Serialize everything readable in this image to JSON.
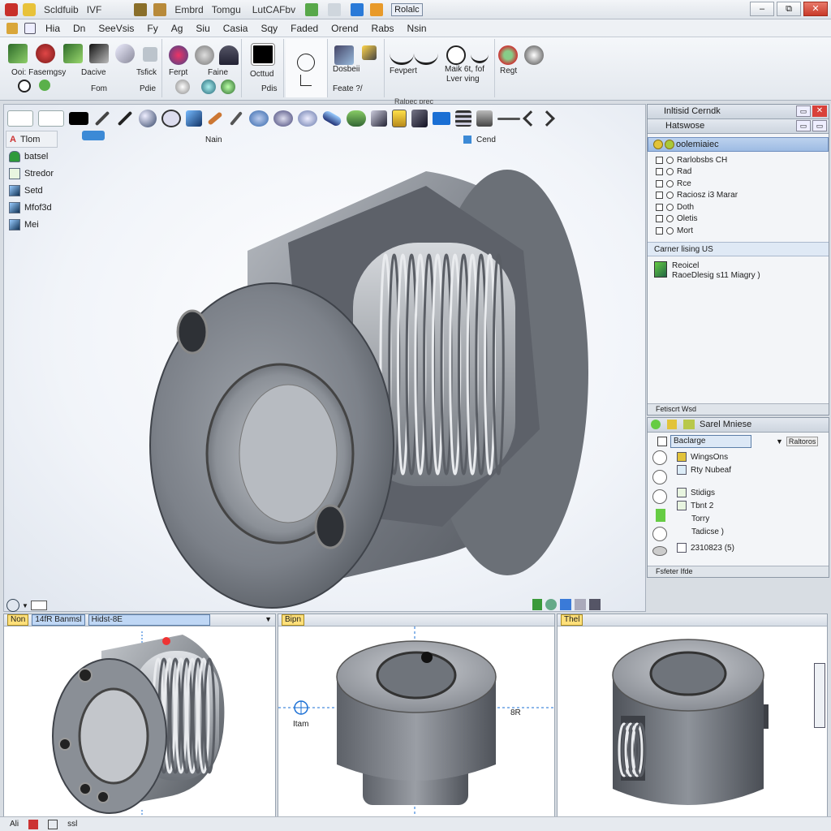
{
  "titlebar": {
    "app_name": "Scldfuib",
    "version": "IVF",
    "doc_combo": "Embrd",
    "doc_combo2": "Tomgu",
    "doc_combo3": "LutCAFbv",
    "search_text": "Rolalc",
    "controls": [
      "–",
      "⧉",
      "✕"
    ]
  },
  "menubar": {
    "items": [
      "Hia",
      "Dn",
      "SeeVsis",
      "Fy",
      "Ag",
      "Siu",
      "Casia",
      "Sqy",
      "Faded",
      "Orend",
      "Rabs",
      "Nsin"
    ]
  },
  "ribbon": {
    "groups": [
      {
        "label_top": "Ooi: Fasemgsy",
        "label_bottom": "Fom"
      },
      {
        "label_top": "Dacive",
        "label_bottom": ""
      },
      {
        "label_top": "Tsfick",
        "label_bottom": "Pdie"
      },
      {
        "label_top": "Ferpt",
        "label_bottom": ""
      },
      {
        "label_top": "Faine",
        "label_bottom": ""
      },
      {
        "label_top": "Octtud",
        "label_bottom": "Pdis"
      },
      {
        "label_top": "Dosbeii",
        "label_bottom": "Feate ?/"
      },
      {
        "label_top": "Fevpert",
        "label_bottom": ""
      },
      {
        "label_top": "Maik 6t, fof",
        "label_bottom": "Lver ving"
      },
      {
        "label_top": "Regt",
        "label_bottom": ""
      }
    ],
    "caption": "Ralpec prec"
  },
  "graphics": {
    "hud_label_main": "Nain",
    "hud_label_cond": "Cend",
    "tree_head": "Tlom",
    "tree_items": [
      {
        "label": "batsel",
        "color": "#2e9a3a"
      },
      {
        "label": "Stredor",
        "color": "#e8f5e0"
      },
      {
        "label": "Setd",
        "color": "#3b8ad9"
      },
      {
        "label": "Mfof3d",
        "color": "#3b8ad9"
      },
      {
        "label": "Mei",
        "color": "#3b8ad9"
      }
    ]
  },
  "panel_top": {
    "title": "Inltisid Cerndk",
    "subtitle": "Hatswose",
    "selected": "oolemiaiec",
    "options": [
      {
        "label": "Rarlobsbs CH",
        "kind": "radio"
      },
      {
        "label": "Rad",
        "kind": "radio"
      },
      {
        "label": "Rce",
        "kind": "radio"
      },
      {
        "label": "Raciosz i3 Marar",
        "kind": "radio"
      },
      {
        "label": "Doth",
        "kind": "radio"
      },
      {
        "label": "Oletis",
        "kind": "radio"
      },
      {
        "label": "Mort",
        "kind": "radio"
      }
    ],
    "sub_head": "Carner lising US",
    "material_line1": "Reoicel",
    "material_line2": "RaoeDlesig s11 Miagry )",
    "footer": "Fetiscrt Wsd"
  },
  "panel_bottom": {
    "title": "Sarel Mniese",
    "field_value": "Baclarge",
    "field_button": "Raltoros",
    "rows": [
      {
        "label": "WingsOns",
        "color": "#e2c33a"
      },
      {
        "label": "Rty Nubeaf",
        "color": "#dcecf7"
      },
      {
        "label": "Stidigs",
        "color": "#e8f5e0"
      },
      {
        "label": "Tbnt 2",
        "color": "#e8f5e0"
      },
      {
        "label": "Torry",
        "color": "#ffffff"
      },
      {
        "label": "Tadicse )",
        "color": "#ffffff"
      },
      {
        "label": "2310823 (5)",
        "color": "#ffffff"
      }
    ],
    "footer": "Fsfeter Ifde"
  },
  "viewports": [
    {
      "tag": "Non",
      "tab_label": "14fR Banmsl",
      "tab_label2": "Hidst-8E"
    },
    {
      "tag": "Bipn",
      "tab_label": "",
      "tab_label2": "",
      "dim_left": "Itam",
      "dim_right": "8R"
    },
    {
      "tag": "Thel",
      "tab_label": "",
      "tab_label2": ""
    }
  ],
  "statusbar": {
    "items": [
      "Ali",
      "ssl"
    ]
  }
}
